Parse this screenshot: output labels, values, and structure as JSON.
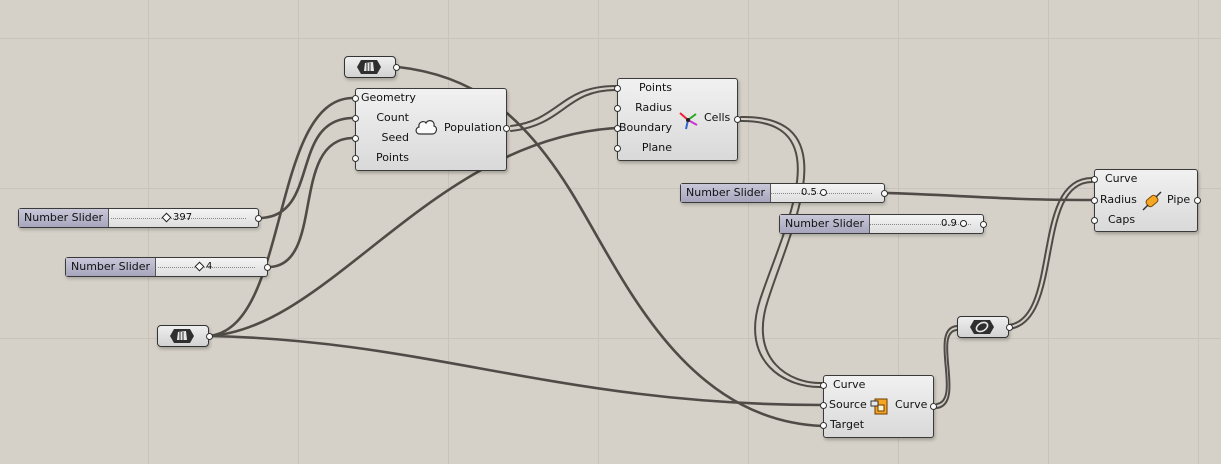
{
  "components": {
    "populate": {
      "inputs": [
        "Geometry",
        "Count",
        "Seed",
        "Points"
      ],
      "output": "Population",
      "icon": "cloud-icon"
    },
    "voronoi": {
      "inputs": [
        "Points",
        "Radius",
        "Boundary",
        "Plane"
      ],
      "output": "Cells",
      "icon": "voronoi-icon"
    },
    "pipe": {
      "inputs": [
        "Curve",
        "Radius",
        "Caps"
      ],
      "output": "Pipe",
      "icon": "pipe-icon"
    },
    "project": {
      "inputs": [
        "Curve",
        "Source",
        "Target"
      ],
      "output": "Curve",
      "icon": "project-icon"
    }
  },
  "sliders": [
    {
      "name": "Number Slider",
      "value": "397",
      "level": 0.55
    },
    {
      "name": "Number Slider",
      "value": "4",
      "level": 0.45
    },
    {
      "name": "Number Slider",
      "value": "0.5",
      "level": 0.55
    },
    {
      "name": "Number Slider",
      "value": "0.9",
      "level": 0.9
    }
  ],
  "params": [
    {
      "icon": "brep-param-icon"
    },
    {
      "icon": "brep-param-icon"
    },
    {
      "icon": "curve-param-icon"
    }
  ],
  "colors": {
    "canvas": "#d5d1c8",
    "grid": "#c8c4bb",
    "wire": "#4f4b46",
    "slider_name": "#a7a5bd",
    "icon_orange": "#f5a623"
  }
}
